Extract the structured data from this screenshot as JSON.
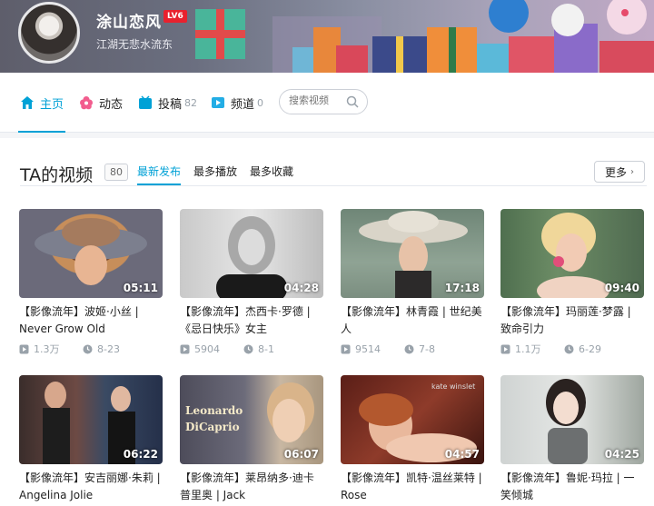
{
  "profile": {
    "username": "涂山恋风",
    "level": "LV6",
    "signature": "江湖无悲水流东"
  },
  "nav": {
    "items": [
      {
        "label": "主页",
        "count": "",
        "icon": "home-icon"
      },
      {
        "label": "动态",
        "count": "",
        "icon": "flower-icon"
      },
      {
        "label": "投稿",
        "count": "82",
        "icon": "upload-icon"
      },
      {
        "label": "频道",
        "count": "0",
        "icon": "channel-icon"
      }
    ],
    "search_placeholder": "搜索视频"
  },
  "section": {
    "title": "TA的视频",
    "count": "80",
    "tabs": [
      "最新发布",
      "最多播放",
      "最多收藏"
    ],
    "more_label": "更多"
  },
  "colors": {
    "accent": "#00a1d6",
    "level_badge": "#e8212e"
  },
  "videos": [
    {
      "title": "【影像流年】波姬·小丝 | Never Grow Old",
      "duration": "05:11",
      "plays": "1.3万",
      "date": "8-23"
    },
    {
      "title": "【影像流年】杰西卡·罗德 | 《忌日快乐》女主",
      "duration": "04:28",
      "plays": "5904",
      "date": "8-1"
    },
    {
      "title": "【影像流年】林青霞 | 世纪美人",
      "duration": "17:18",
      "plays": "9514",
      "date": "7-8"
    },
    {
      "title": "【影像流年】玛丽莲·梦露 | 致命引力",
      "duration": "09:40",
      "plays": "1.1万",
      "date": "6-29"
    },
    {
      "title": "【影像流年】安吉丽娜·朱莉 | Angelina Jolie",
      "duration": "06:22",
      "plays": "",
      "date": ""
    },
    {
      "title": "【影像流年】莱昂纳多·迪卡普里奥 | Jack",
      "duration": "06:07",
      "plays": "",
      "date": "",
      "overlay": "Leonardo DiCaprio"
    },
    {
      "title": "【影像流年】凯特·温丝莱特 | Rose",
      "duration": "04:57",
      "plays": "",
      "date": "",
      "overlay": "kate winslet"
    },
    {
      "title": "【影像流年】鲁妮·玛拉 | 一笑倾城",
      "duration": "04:25",
      "plays": "",
      "date": ""
    }
  ]
}
